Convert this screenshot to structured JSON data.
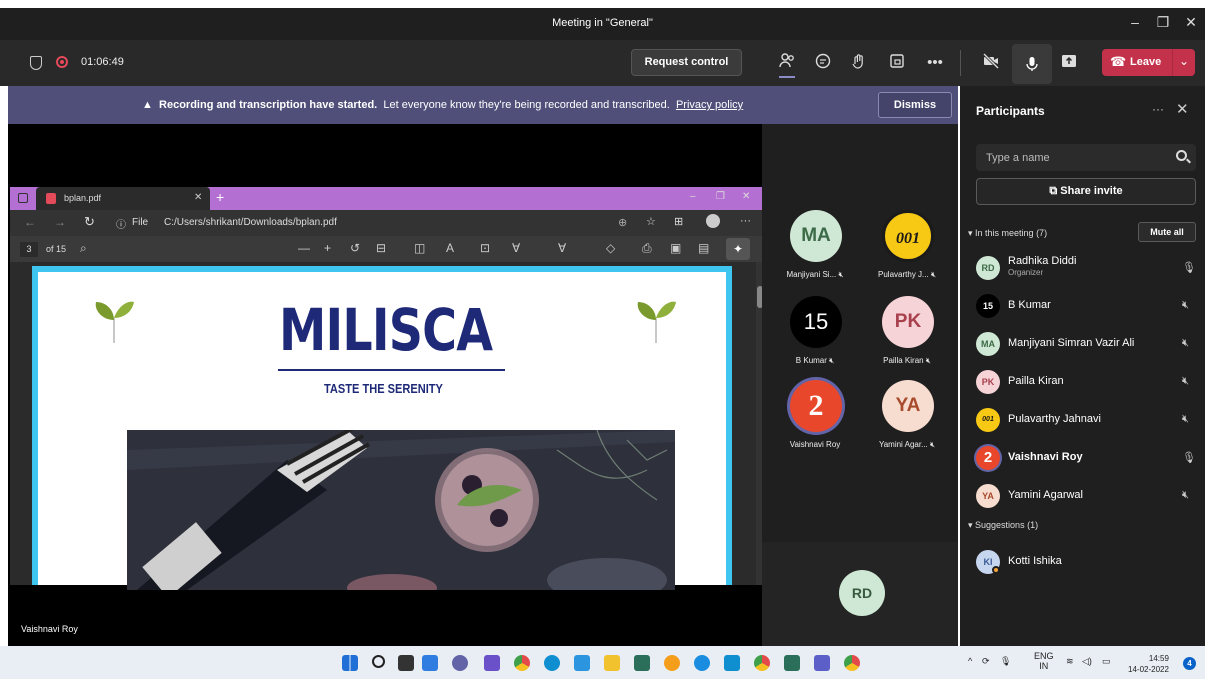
{
  "window": {
    "title": "Meeting in \"General\"",
    "controls": [
      "minimize-icon",
      "maximize-icon",
      "close-icon"
    ]
  },
  "toolbar": {
    "timer": "01:06:49",
    "request_control": "Request control",
    "leave": "Leave",
    "icons": [
      "people-icon",
      "chat-icon",
      "reactions-icon",
      "rooms-icon",
      "more-icon",
      "camera-off-icon",
      "mic-icon",
      "share-icon"
    ]
  },
  "banner": {
    "bold": "Recording and transcription have started.",
    "text": "Let everyone know they're being recorded and transcribed.",
    "link": "Privacy policy",
    "dismiss": "Dismiss"
  },
  "pdf": {
    "tab_name": "bplan.pdf",
    "file_label": "File",
    "url": "C:/Users/shrikant/Downloads/bplan.pdf",
    "page_current": "3",
    "page_total": "of 15",
    "brand": "MILISCA",
    "tagline": "TASTE THE SERENITY"
  },
  "stage": {
    "presenter_name": "Vaishnavi Roy"
  },
  "gallery": {
    "tiles": [
      {
        "initials": "MA",
        "name": "Manjiyani Si...",
        "bg": "#cfe8d5",
        "fg": "#3d6a47"
      },
      {
        "initials": "001",
        "name": "Pulavarthy J...",
        "bg": "#f7c814",
        "fg": "#1a1a1a"
      },
      {
        "initials": "15",
        "name": "B Kumar",
        "bg": "#000000",
        "fg": "#ffffff"
      },
      {
        "initials": "PK",
        "name": "Pailla Kiran",
        "bg": "#f6d3d6",
        "fg": "#a8404e"
      },
      {
        "initials": "2",
        "name": "Vaishnavi Roy",
        "bg": "#e8472c",
        "fg": "#ffffff"
      },
      {
        "initials": "YA",
        "name": "Yamini Agar...",
        "bg": "#f7dcd0",
        "fg": "#a84a2c"
      }
    ],
    "bottom_initials": "RD"
  },
  "participants": {
    "title": "Participants",
    "search_placeholder": "Type a name",
    "share_invite": "Share invite",
    "in_meeting_label": "In this meeting (7)",
    "mute_all": "Mute all",
    "members": [
      {
        "initials": "RD",
        "name": "Radhika Diddi",
        "role": "Organizer",
        "mic": "mic-on",
        "bg": "#cfe8d5",
        "fg": "#3d6a47"
      },
      {
        "initials": "15",
        "name": "B Kumar",
        "role": "",
        "mic": "mic-off",
        "bg": "#000000",
        "fg": "#ffffff"
      },
      {
        "initials": "MA",
        "name": "Manjiyani Simran Vazir Ali",
        "role": "",
        "mic": "mic-off",
        "bg": "#cfe8d5",
        "fg": "#3d6a47"
      },
      {
        "initials": "PK",
        "name": "Pailla Kiran",
        "role": "",
        "mic": "mic-off",
        "bg": "#f6d3d6",
        "fg": "#a8404e"
      },
      {
        "initials": "001",
        "name": "Pulavarthy Jahnavi",
        "role": "",
        "mic": "mic-off",
        "bg": "#f7c814",
        "fg": "#1a1a1a"
      },
      {
        "initials": "2",
        "name": "Vaishnavi Roy",
        "role": "",
        "mic": "mic-on",
        "bg": "#e8472c",
        "fg": "#ffffff"
      },
      {
        "initials": "YA",
        "name": "Yamini Agarwal",
        "role": "",
        "mic": "mic-off",
        "bg": "#f7dcd0",
        "fg": "#a84a2c"
      }
    ],
    "suggestions_label": "Suggestions (1)",
    "suggestions": [
      {
        "initials": "KI",
        "name": "Kotti Ishika",
        "bg": "#c7d6ef",
        "fg": "#3a5a95"
      }
    ]
  },
  "taskbar": {
    "lang": "ENG",
    "region": "IN",
    "time": "14:59",
    "date": "14-02-2022",
    "notifications": "4"
  },
  "colors": {
    "accent_leave": "#c4314b",
    "banner": "#4f4f7a",
    "panel": "#1f1f1f",
    "pdf_tab_bar": "#b36fd1",
    "brand_navy": "#1e2a78"
  }
}
